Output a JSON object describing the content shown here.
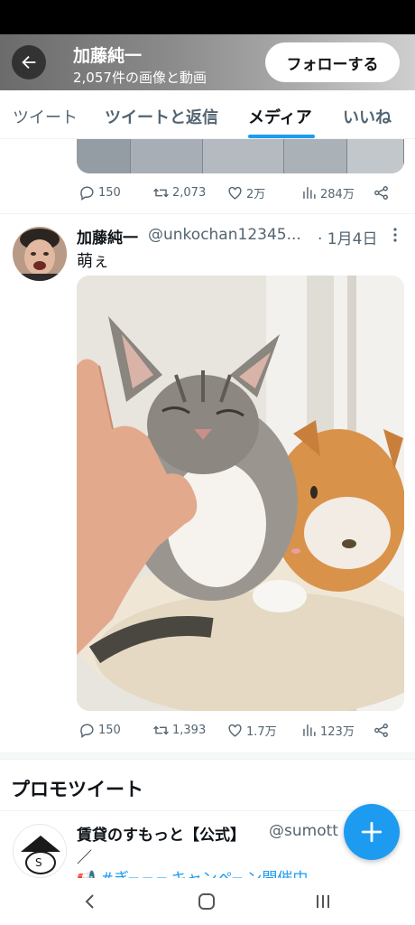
{
  "header": {
    "name": "加藤純一",
    "media_count": "2,057件の画像と動画",
    "follow_label": "フォローする"
  },
  "tabs": [
    {
      "label": "ツイート",
      "active": false
    },
    {
      "label": "ツイートと返信",
      "active": false
    },
    {
      "label": "メディア",
      "active": true
    },
    {
      "label": "いいね",
      "active": false
    }
  ],
  "prev_tweet": {
    "replies": "150",
    "retweets": "2,073",
    "likes": "2万",
    "views": "284万"
  },
  "tweet": {
    "name": "加藤純一",
    "handle": "@unkochan12345...",
    "date": "· 1月4日",
    "text": "萌ぇ",
    "replies": "150",
    "retweets": "1,393",
    "likes": "1.7万",
    "views": "123万"
  },
  "promo": {
    "section_title": "プロモツイート",
    "name": "賃貸のすもっと【公式】",
    "handle": "@sumott",
    "line2": "／",
    "line3": "📢 #ぎ─ ─ ─ キャンペ─ ン開催中"
  },
  "colors": {
    "accent": "#1d9bf0",
    "text": "#0f1419",
    "muted": "#536471"
  }
}
